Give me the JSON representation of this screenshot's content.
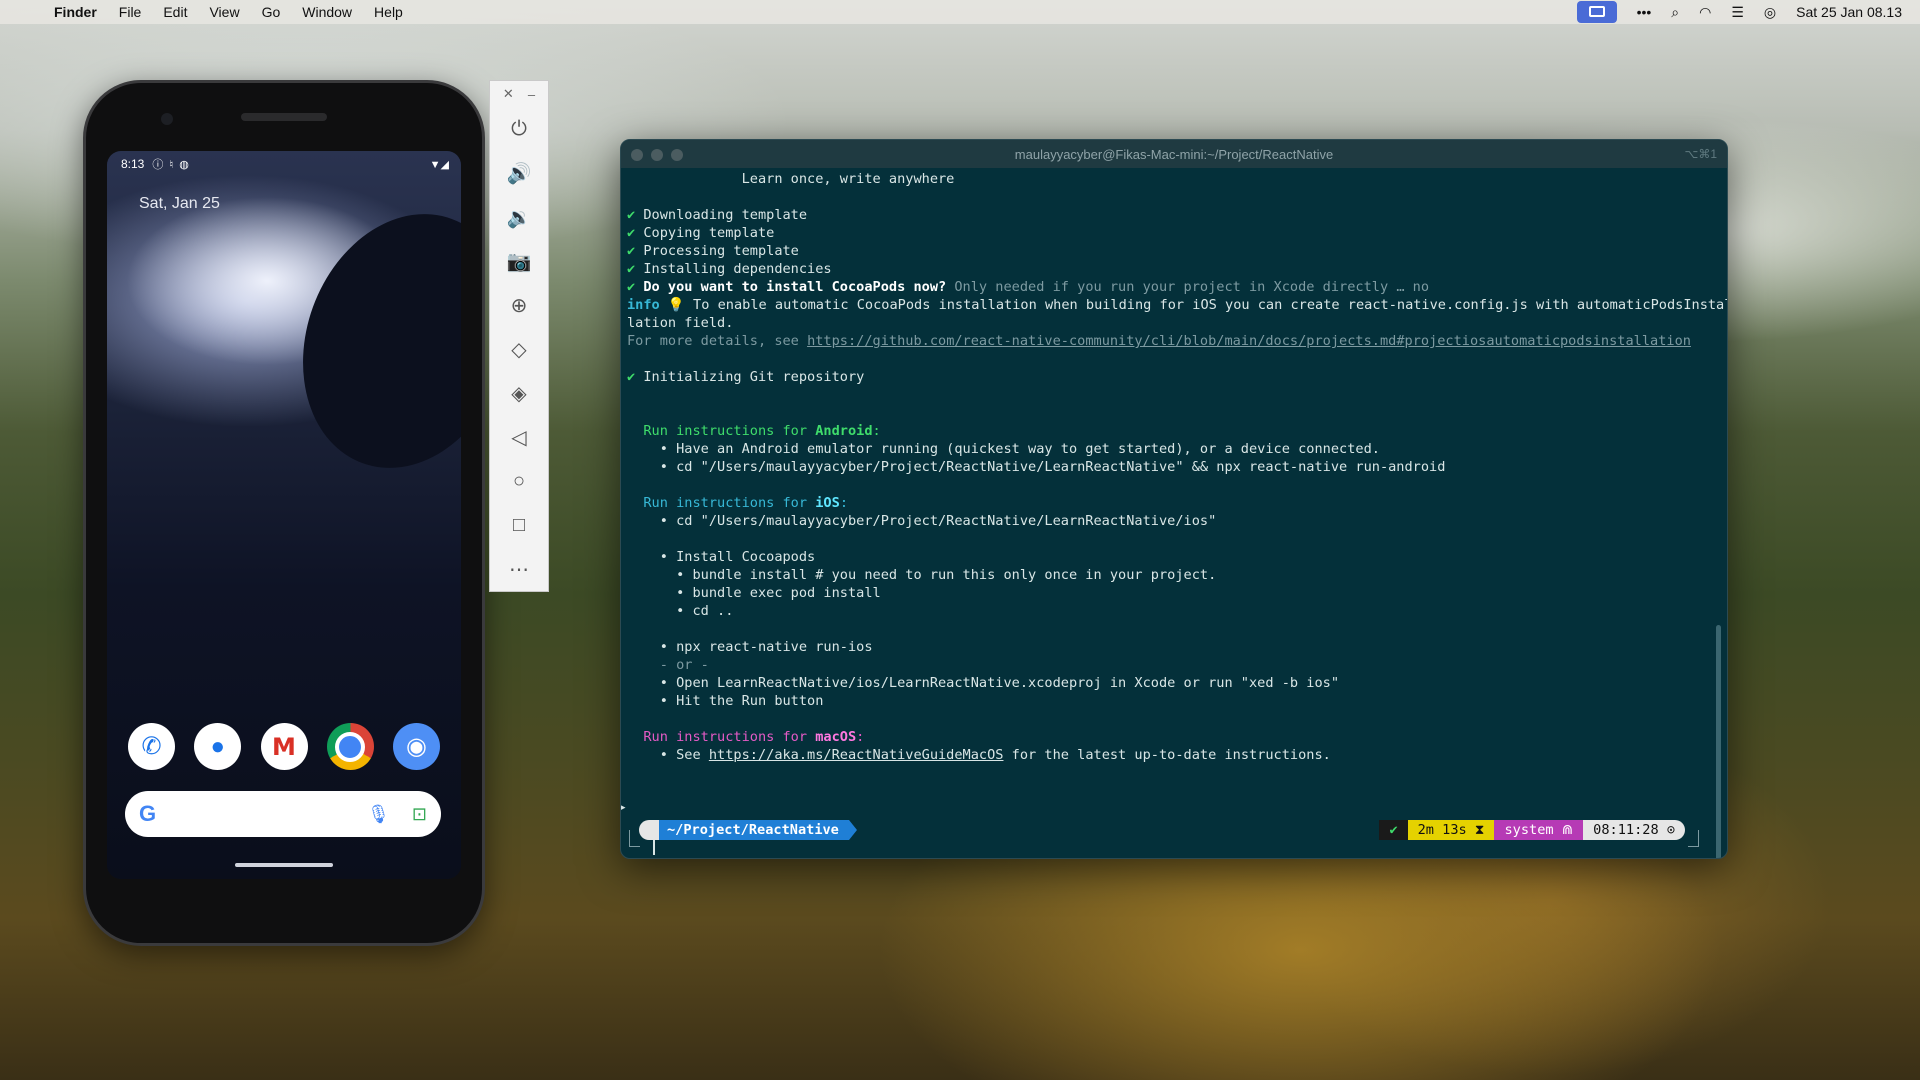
{
  "menubar": {
    "apple": "",
    "items": [
      "Finder",
      "File",
      "Edit",
      "View",
      "Go",
      "Window",
      "Help"
    ],
    "clock": "Sat 25 Jan 08.13"
  },
  "phone": {
    "status_time": "8:13",
    "date": "Sat, Jan 25",
    "dock_icons": [
      "phone-icon",
      "messages-icon",
      "gmail-icon",
      "chrome-icon",
      "camera-icon"
    ],
    "search_logo": "G"
  },
  "terminal": {
    "title": "maulayyacyber@Fikas-Mac-mini:~/Project/ReactNative",
    "shortcut": "⌥⌘1",
    "lines": {
      "l0": "              Learn once, write anywhere",
      "l1": " Downloading template",
      "l2": " Copying template",
      "l3": " Processing template",
      "l4": " Installing dependencies",
      "l5a": " Do you want to install CocoaPods now?",
      "l5b": " Only needed if you run your project in Xcode directly … no",
      "l6a": "info",
      "l6b": " 💡 To enable automatic CocoaPods installation when building for iOS you can create react-native.config.js with automaticPodsInstal",
      "l7": "lation field.",
      "l8a": "For more details, see ",
      "l8b": "https://github.com/react-native-community/cli/blob/main/docs/projects.md#projectiosautomaticpodsinstallation",
      "l9": " Initializing Git repository",
      "android_a": "  Run instructions for ",
      "android_b": "Android",
      "android_c": ":",
      "a1": "    • Have an Android emulator running (quickest way to get started), or a device connected.",
      "a2": "    • cd \"/Users/maulayyacyber/Project/ReactNative/LearnReactNative\" && npx react-native run-android",
      "ios_a": "  Run instructions for ",
      "ios_b": "iOS",
      "ios_c": ":",
      "i1": "    • cd \"/Users/maulayyacyber/Project/ReactNative/LearnReactNative/ios\"",
      "i2": "    • Install Cocoapods",
      "i3": "      • bundle install # you need to run this only once in your project.",
      "i4": "      • bundle exec pod install",
      "i5": "      • cd ..",
      "i6": "    • npx react-native run-ios",
      "i7": "    - or -",
      "i8": "    • Open LearnReactNative/ios/LearnReactNative.xcodeproj in Xcode or run \"xed -b ios\"",
      "i9": "    • Hit the Run button",
      "mac_a": "  Run instructions for ",
      "mac_b": "macOS",
      "mac_c": ":",
      "m1a": "    • See ",
      "m1b": "https://aka.ms/ReactNativeGuideMacOS",
      "m1c": " for the latest up-to-date instructions."
    },
    "prompt": {
      "apple": "",
      "dir": "~/Project/ReactNative",
      "ok": "✔",
      "duration": "2m 13s ⧗",
      "env": "system ⋒",
      "clock": "08:11:28 ⊙"
    }
  }
}
